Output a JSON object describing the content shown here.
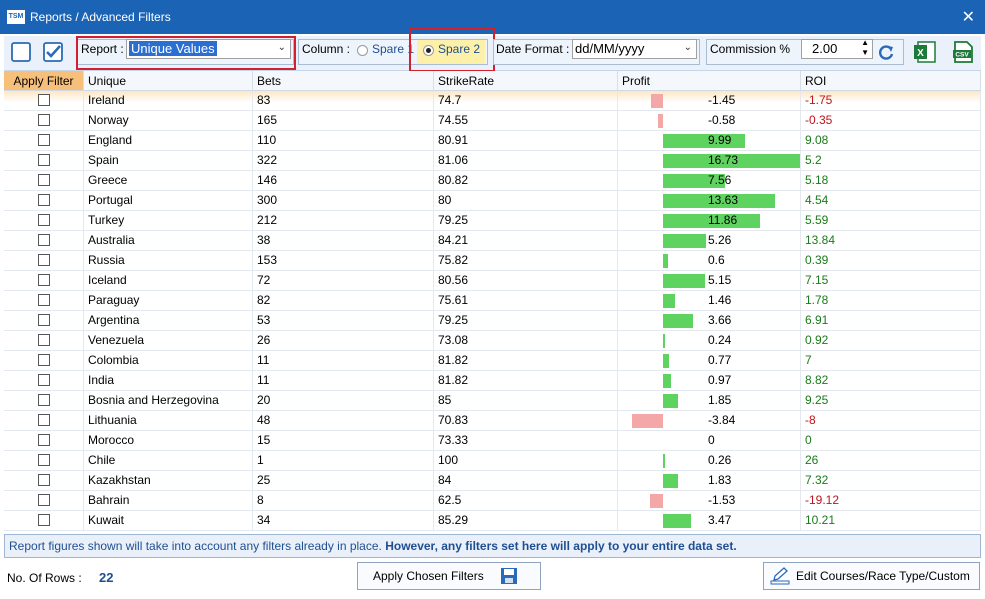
{
  "window": {
    "title": "Reports / Advanced Filters",
    "app_icon_text": "TSM",
    "close_glyph": "✕"
  },
  "toolbar": {
    "report_label": "Report :",
    "report_value": "Unique Values",
    "column_label": "Column :",
    "column_options": [
      {
        "label": "Spare 1",
        "selected": false
      },
      {
        "label": "Spare 2",
        "selected": true
      }
    ],
    "date_format_label": "Date Format :",
    "date_format_value": "dd/MM/yyyy",
    "commission_label": "Commission %",
    "commission_value": "2.00",
    "icons": [
      "unchecked-box-icon",
      "checked-box-icon",
      "refresh-icon",
      "excel-icon",
      "csv-icon"
    ]
  },
  "table": {
    "columns": [
      "Apply Filter",
      "Unique",
      "Bets",
      "StrikeRate",
      "Profit",
      "ROI"
    ],
    "profit_scale_max": 16.73,
    "rows": [
      {
        "unique": "Ireland",
        "bets": "83",
        "strike": "74.7",
        "profit": "-1.45",
        "roi": "-1.75"
      },
      {
        "unique": "Norway",
        "bets": "165",
        "strike": "74.55",
        "profit": "-0.58",
        "roi": "-0.35"
      },
      {
        "unique": "England",
        "bets": "110",
        "strike": "80.91",
        "profit": "9.99",
        "roi": "9.08"
      },
      {
        "unique": "Spain",
        "bets": "322",
        "strike": "81.06",
        "profit": "16.73",
        "roi": "5.2"
      },
      {
        "unique": "Greece",
        "bets": "146",
        "strike": "80.82",
        "profit": "7.56",
        "roi": "5.18"
      },
      {
        "unique": "Portugal",
        "bets": "300",
        "strike": "80",
        "profit": "13.63",
        "roi": "4.54"
      },
      {
        "unique": "Turkey",
        "bets": "212",
        "strike": "79.25",
        "profit": "11.86",
        "roi": "5.59"
      },
      {
        "unique": "Australia",
        "bets": "38",
        "strike": "84.21",
        "profit": "5.26",
        "roi": "13.84"
      },
      {
        "unique": "Russia",
        "bets": "153",
        "strike": "75.82",
        "profit": "0.6",
        "roi": "0.39"
      },
      {
        "unique": "Iceland",
        "bets": "72",
        "strike": "80.56",
        "profit": "5.15",
        "roi": "7.15"
      },
      {
        "unique": "Paraguay",
        "bets": "82",
        "strike": "75.61",
        "profit": "1.46",
        "roi": "1.78"
      },
      {
        "unique": "Argentina",
        "bets": "53",
        "strike": "79.25",
        "profit": "3.66",
        "roi": "6.91"
      },
      {
        "unique": "Venezuela",
        "bets": "26",
        "strike": "73.08",
        "profit": "0.24",
        "roi": "0.92"
      },
      {
        "unique": "Colombia",
        "bets": "11",
        "strike": "81.82",
        "profit": "0.77",
        "roi": "7"
      },
      {
        "unique": "India",
        "bets": "11",
        "strike": "81.82",
        "profit": "0.97",
        "roi": "8.82"
      },
      {
        "unique": "Bosnia and Herzegovina",
        "bets": "20",
        "strike": "85",
        "profit": "1.85",
        "roi": "9.25"
      },
      {
        "unique": "Lithuania",
        "bets": "48",
        "strike": "70.83",
        "profit": "-3.84",
        "roi": "-8"
      },
      {
        "unique": "Morocco",
        "bets": "15",
        "strike": "73.33",
        "profit": "0",
        "roi": "0"
      },
      {
        "unique": "Chile",
        "bets": "1",
        "strike": "100",
        "profit": "0.26",
        "roi": "26"
      },
      {
        "unique": "Kazakhstan",
        "bets": "25",
        "strike": "84",
        "profit": "1.83",
        "roi": "7.32"
      },
      {
        "unique": "Bahrain",
        "bets": "8",
        "strike": "62.5",
        "profit": "-1.53",
        "roi": "-19.12"
      },
      {
        "unique": "Kuwait",
        "bets": "34",
        "strike": "85.29",
        "profit": "3.47",
        "roi": "10.21"
      }
    ]
  },
  "info": {
    "notice_normal": "Report figures shown will take into account any filters already in place. ",
    "notice_bold": "However, any filters set here will apply to your entire data set."
  },
  "footer": {
    "rows_label": "No. Of Rows :",
    "rows_count": "22",
    "apply_button": "Apply Chosen Filters",
    "edit_button": "Edit Courses/Race Type/Custom"
  },
  "colors": {
    "title_bar": "#1b63b4",
    "positive_bar": "#5fd35f",
    "negative_bar": "#f4a7a7",
    "highlight_border": "#d2202f",
    "apply_header": "#f7c07a"
  }
}
